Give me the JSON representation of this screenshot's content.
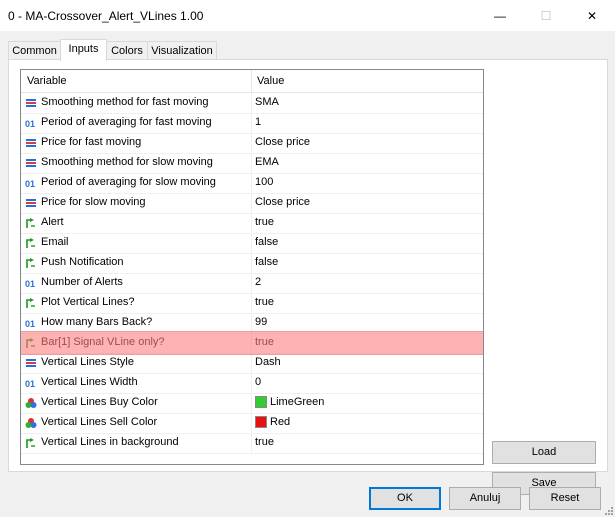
{
  "window": {
    "title": "0 - MA-Crossover_Alert_VLines 1.00",
    "minimize_label": "—",
    "maximize_label": "☐",
    "close_label": "✕"
  },
  "tabs": [
    {
      "label": "Common"
    },
    {
      "label": "Inputs",
      "active": true
    },
    {
      "label": "Colors"
    },
    {
      "label": "Visualization"
    }
  ],
  "grid": {
    "col_variable": "Variable",
    "col_value": "Value",
    "rows": [
      {
        "icon": "enum-icon",
        "name": "Smoothing method for fast moving",
        "value": "SMA"
      },
      {
        "icon": "int-icon",
        "name": "Period of averaging for fast moving",
        "value": "1"
      },
      {
        "icon": "enum-icon",
        "name": "Price for fast moving",
        "value": "Close price"
      },
      {
        "icon": "enum-icon",
        "name": "Smoothing method for slow moving",
        "value": "EMA"
      },
      {
        "icon": "int-icon",
        "name": "Period of averaging for slow moving",
        "value": "100"
      },
      {
        "icon": "enum-icon",
        "name": "Price for slow moving",
        "value": "Close price"
      },
      {
        "icon": "bool-icon",
        "name": "Alert",
        "value": "true"
      },
      {
        "icon": "bool-icon",
        "name": "Email",
        "value": "false"
      },
      {
        "icon": "bool-icon",
        "name": "Push Notification",
        "value": "false"
      },
      {
        "icon": "int-icon",
        "name": "Number of Alerts",
        "value": "2"
      },
      {
        "icon": "bool-icon",
        "name": "Plot Vertical Lines?",
        "value": "true"
      },
      {
        "icon": "int-icon",
        "name": "How many Bars Back?",
        "value": "99"
      },
      {
        "icon": "bool-icon",
        "name": "Bar[1] Signal VLine only?",
        "value": "true",
        "highlighted": true
      },
      {
        "icon": "enum-icon",
        "name": "Vertical Lines Style",
        "value": "Dash"
      },
      {
        "icon": "int-icon",
        "name": "Vertical Lines Width",
        "value": "0"
      },
      {
        "icon": "color-icon",
        "name": "Vertical Lines Buy Color",
        "value": "LimeGreen",
        "swatch": "#32cd32"
      },
      {
        "icon": "color-icon",
        "name": "Vertical Lines Sell Color",
        "value": "Red",
        "swatch": "#e81010"
      },
      {
        "icon": "bool-icon",
        "name": "Vertical Lines in background",
        "value": "true"
      }
    ]
  },
  "side_buttons": {
    "load": "Load",
    "save": "Save"
  },
  "footer": {
    "ok": "OK",
    "cancel": "Anuluj",
    "reset": "Reset"
  },
  "colors": {
    "highlight": "#ff7f7f",
    "accent": "#0078d7"
  }
}
